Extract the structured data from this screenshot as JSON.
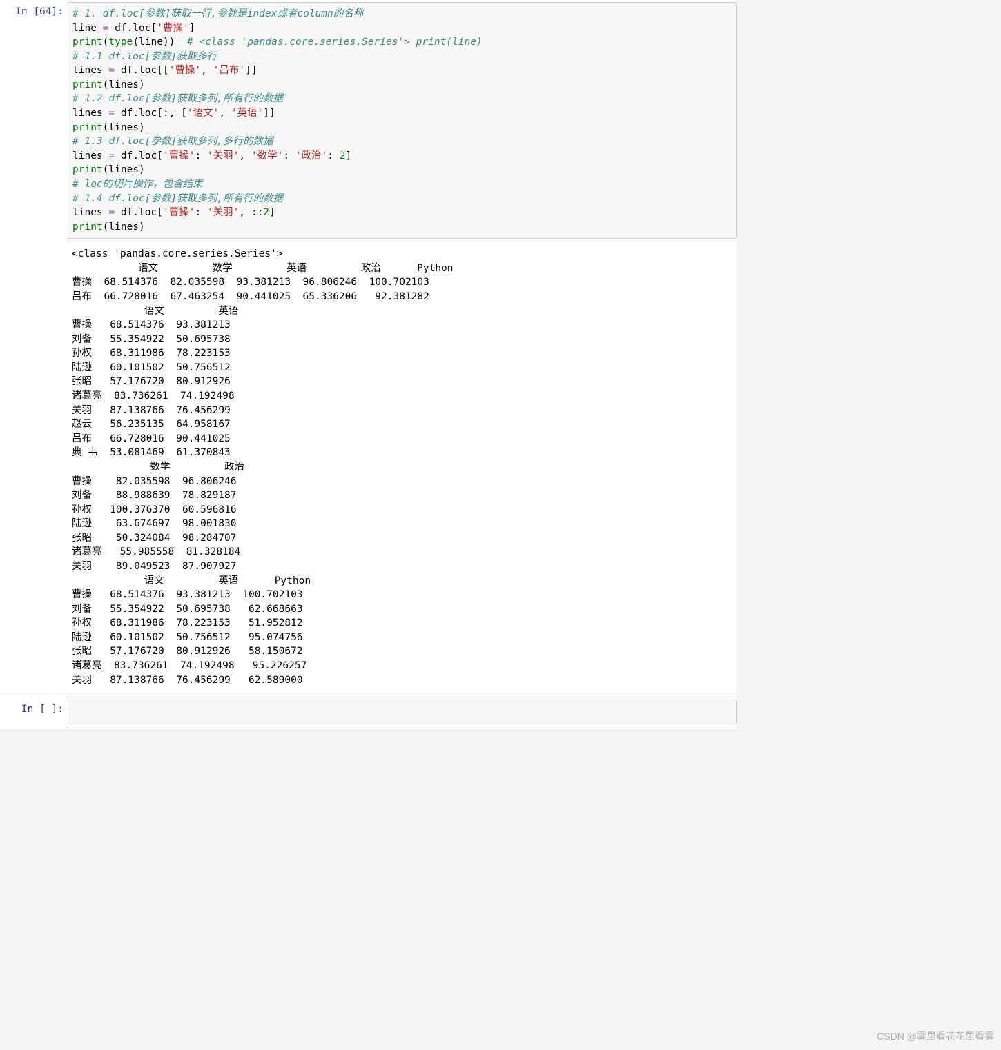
{
  "prompt1": "In [64]:",
  "prompt2": "In [ ]:",
  "watermark": "CSDN @雾里看花花里看雾",
  "code": {
    "l1": "# 1. df.loc[参数]获取一行,参数是index或者column的名称",
    "l2a": "line ",
    "l2b": "=",
    "l2c": " df.loc[",
    "l2d": "'曹操'",
    "l2e": "]",
    "l3a": "print",
    "l3b": "(",
    "l3c": "type",
    "l3d": "(line))  ",
    "l3e": "# <class 'pandas.core.series.Series'> print(line)",
    "l4": "# 1.1 df.loc[参数]获取多行",
    "l5a": "lines ",
    "l5b": "=",
    "l5c": " df.loc[[",
    "l5d": "'曹操'",
    "l5e": ", ",
    "l5f": "'吕布'",
    "l5g": "]]",
    "l6a": "print",
    "l6b": "(lines)",
    "l7": "# 1.2 df.loc[参数]获取多列,所有行的数据",
    "l8a": "lines ",
    "l8b": "=",
    "l8c": " df.loc[:, [",
    "l8d": "'语文'",
    "l8e": ", ",
    "l8f": "'英语'",
    "l8g": "]]",
    "l9a": "print",
    "l9b": "(lines)",
    "l10": "# 1.3 df.loc[参数]获取多列,多行的数据",
    "l11a": "lines ",
    "l11b": "=",
    "l11c": " df.loc[",
    "l11d": "'曹操'",
    "l11e": ": ",
    "l11f": "'关羽'",
    "l11g": ", ",
    "l11h": "'数学'",
    "l11i": ": ",
    "l11j": "'政治'",
    "l11k": ": ",
    "l11l": "2",
    "l11m": "]",
    "l12a": "print",
    "l12b": "(lines)",
    "l13": "# loc的切片操作，包含结束",
    "l14": "# 1.4 df.loc[参数]获取多列,所有行的数据",
    "l15a": "lines ",
    "l15b": "=",
    "l15c": " df.loc[",
    "l15d": "'曹操'",
    "l15e": ": ",
    "l15f": "'关羽'",
    "l15g": ", ::",
    "l15h": "2",
    "l15i": "]",
    "l16a": "print",
    "l16b": "(lines)"
  },
  "output": "<class 'pandas.core.series.Series'>\n           语文         数学         英语         政治      Python\n曹操  68.514376  82.035598  93.381213  96.806246  100.702103\n吕布  66.728016  67.463254  90.441025  65.336206   92.381282\n            语文         英语\n曹操   68.514376  93.381213\n刘备   55.354922  50.695738\n孙权   68.311986  78.223153\n陆逊   60.101502  50.756512\n张昭   57.176720  80.912926\n诸葛亮  83.736261  74.192498\n关羽   87.138766  76.456299\n赵云   56.235135  64.958167\n吕布   66.728016  90.441025\n典 韦  53.081469  61.370843\n             数学         政治\n曹操    82.035598  96.806246\n刘备    88.988639  78.829187\n孙权   100.376370  60.596816\n陆逊    63.674697  98.001830\n张昭    50.324084  98.284707\n诸葛亮   55.985558  81.328184\n关羽    89.049523  87.907927\n            语文         英语      Python\n曹操   68.514376  93.381213  100.702103\n刘备   55.354922  50.695738   62.668663\n孙权   68.311986  78.223153   51.952812\n陆逊   60.101502  50.756512   95.074756\n张昭   57.176720  80.912926   58.150672\n诸葛亮  83.736261  74.192498   95.226257\n关羽   87.138766  76.456299   62.589000"
}
